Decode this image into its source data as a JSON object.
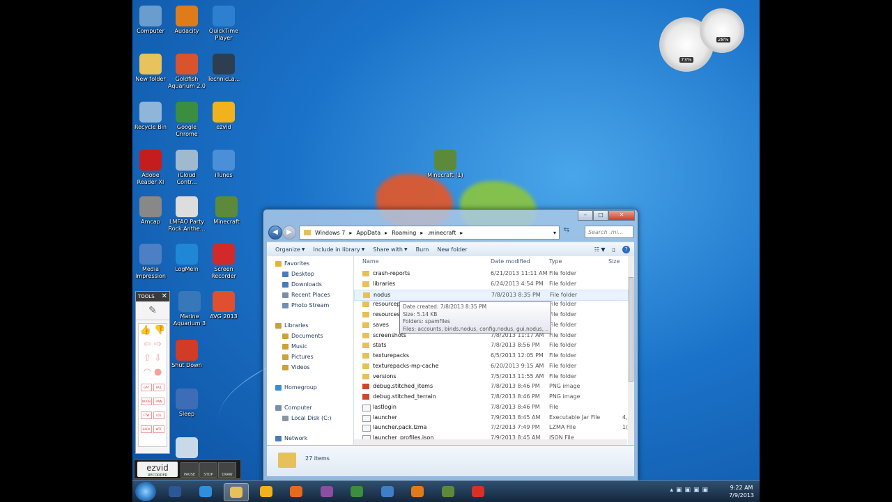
{
  "desktop_icons": [
    {
      "label": "Computer",
      "color": "#6a9ccd"
    },
    {
      "label": "Audacity",
      "color": "#e07b1a"
    },
    {
      "label": "QuickTime Player",
      "color": "#2d7fd0"
    },
    {
      "label": "New folder",
      "color": "#e8c25a"
    },
    {
      "label": "Goldfish Aquarium 2.0",
      "color": "#d9532c"
    },
    {
      "label": "TechnicLa...",
      "color": "#2c3e50"
    },
    {
      "label": "Recycle Bin",
      "color": "#8fb6d8"
    },
    {
      "label": "Google Chrome",
      "color": "#3b8e3f"
    },
    {
      "label": "ezvid",
      "color": "#f2b21b"
    },
    {
      "label": "Adobe Reader XI",
      "color": "#c51d1d"
    },
    {
      "label": "iCloud Contr...",
      "color": "#9fb9cf"
    },
    {
      "label": "iTunes",
      "color": "#4a8fd8"
    },
    {
      "label": "Amcap",
      "color": "#888888"
    },
    {
      "label": "LMFAO Party Rock Anthe...",
      "color": "#dddddd"
    },
    {
      "label": "Minecraft",
      "color": "#5d8a3a"
    },
    {
      "label": "Media Impression",
      "color": "#4d7fc4"
    },
    {
      "label": "LogMeIn",
      "color": "#1f87d6"
    },
    {
      "label": "Screen Recorder",
      "color": "#d22a2a"
    },
    {
      "label": "Marine Aquarium 3",
      "color": "#3778b8"
    },
    {
      "label": "AVG 2013",
      "color": "#e05030"
    },
    {
      "label": "Shut Down",
      "color": "#d23b25"
    },
    {
      "label": "Sleep",
      "color": "#3c6db6"
    },
    {
      "label": "",
      "color": "#c9d9e8"
    },
    {
      "label": "Minecraft (1)",
      "color": "#5d8a3a"
    }
  ],
  "gadget": {
    "cpu": "73%",
    "mem": "28%"
  },
  "tools": {
    "title": "TOOLS",
    "close": "✕"
  },
  "ezvid": {
    "logo": "ezvid",
    "sub": "RECORDER",
    "pause": "PAUSE",
    "stop": "STOP",
    "draw": "DRAW"
  },
  "window": {
    "path": [
      "Windows 7",
      "AppData",
      "Roaming",
      ".minecraft"
    ],
    "search_placeholder": "Search .mi...",
    "toolbar": [
      "Organize",
      "Include in library",
      "Share with",
      "Burn",
      "New folder"
    ],
    "nav": [
      {
        "label": "Favorites",
        "color": "#e8b52a"
      },
      {
        "label": "Desktop",
        "color": "#4a7ab8"
      },
      {
        "label": "Downloads",
        "color": "#4a7ab8"
      },
      {
        "label": "Recent Places",
        "color": "#7a8fa6"
      },
      {
        "label": "Photo Stream",
        "color": "#6c90b8"
      },
      {
        "label": "Libraries",
        "color": "#c9a23a"
      },
      {
        "label": "Documents",
        "color": "#c9a23a"
      },
      {
        "label": "Music",
        "color": "#c9a23a"
      },
      {
        "label": "Pictures",
        "color": "#c9a23a"
      },
      {
        "label": "Videos",
        "color": "#c9a23a"
      },
      {
        "label": "Homegroup",
        "color": "#3a8fd2"
      },
      {
        "label": "Computer",
        "color": "#7a8fa6"
      },
      {
        "label": "Local Disk (C:)",
        "color": "#8a96a2"
      },
      {
        "label": "Network",
        "color": "#4a7ab8"
      }
    ],
    "columns": {
      "name": "Name",
      "date": "Date modified",
      "type": "Type",
      "size": "Size"
    },
    "files": [
      {
        "name": "crash-reports",
        "date": "6/21/2013 11:11 AM",
        "type": "File folder",
        "size": "",
        "kind": "folder"
      },
      {
        "name": "libraries",
        "date": "6/24/2013 4:54 PM",
        "type": "File folder",
        "size": "",
        "kind": "folder"
      },
      {
        "name": "nodus",
        "date": "7/8/2013 8:35 PM",
        "type": "File folder",
        "size": "",
        "kind": "folder"
      },
      {
        "name": "resourcepa",
        "date": "",
        "type": "File folder",
        "size": "",
        "kind": "folder"
      },
      {
        "name": "resources",
        "date": "",
        "type": "File folder",
        "size": "",
        "kind": "folder"
      },
      {
        "name": "saves",
        "date": "",
        "type": "File folder",
        "size": "",
        "kind": "folder"
      },
      {
        "name": "screenshots",
        "date": "7/8/2013 11:17 AM",
        "type": "File folder",
        "size": "",
        "kind": "folder"
      },
      {
        "name": "stats",
        "date": "7/8/2013 8:56 PM",
        "type": "File folder",
        "size": "",
        "kind": "folder"
      },
      {
        "name": "texturepacks",
        "date": "6/5/2013 12:05 PM",
        "type": "File folder",
        "size": "",
        "kind": "folder"
      },
      {
        "name": "texturepacks-mp-cache",
        "date": "6/20/2013 9:15 AM",
        "type": "File folder",
        "size": "",
        "kind": "folder"
      },
      {
        "name": "versions",
        "date": "7/5/2013 11:55 AM",
        "type": "File folder",
        "size": "",
        "kind": "folder"
      },
      {
        "name": "debug.stitched_items",
        "date": "7/8/2013 8:46 PM",
        "type": "PNG image",
        "size": "",
        "kind": "png"
      },
      {
        "name": "debug.stitched_terrain",
        "date": "7/8/2013 8:46 PM",
        "type": "PNG image",
        "size": "",
        "kind": "png"
      },
      {
        "name": "lastlogin",
        "date": "7/8/2013 8:46 PM",
        "type": "File",
        "size": "",
        "kind": "file"
      },
      {
        "name": "launcher",
        "date": "7/9/2013 8:45 AM",
        "type": "Executable Jar File",
        "size": "4,",
        "kind": "file"
      },
      {
        "name": "launcher.pack.lzma",
        "date": "7/2/2013 7:49 PM",
        "type": "LZMA File",
        "size": "1(",
        "kind": "file"
      },
      {
        "name": "launcher_profiles.json",
        "date": "7/9/2013 8:45 AM",
        "type": "JSON File",
        "size": "",
        "kind": "file"
      }
    ],
    "tooltip": {
      "created": "Date created: 7/8/2013 8:35 PM",
      "size": "Size: 5.14 KB",
      "folders": "Folders: spamfiles",
      "files": "Files: accounts, binds.nodus, config.nodus, gui.nodus, ..."
    },
    "status": "27 items"
  },
  "taskbar": {
    "apps": [
      {
        "name": "word-icon",
        "color": "#2b5797"
      },
      {
        "name": "ie-icon",
        "color": "#2f8fdc"
      },
      {
        "name": "explorer-icon",
        "color": "#e6c15a"
      },
      {
        "name": "ezvid-icon",
        "color": "#f2b21b"
      },
      {
        "name": "firefox-icon",
        "color": "#e66a1d"
      },
      {
        "name": "winrar-icon",
        "color": "#8a4fa3"
      },
      {
        "name": "chrome-icon",
        "color": "#3b8e3f"
      },
      {
        "name": "safari-icon",
        "color": "#3f7fc7"
      },
      {
        "name": "audacity-icon",
        "color": "#e07b1a"
      },
      {
        "name": "minecraft-icon",
        "color": "#5d8a3a"
      },
      {
        "name": "gmail-icon",
        "color": "#d93025"
      }
    ],
    "time": "9:22 AM",
    "date": "7/9/2013"
  }
}
